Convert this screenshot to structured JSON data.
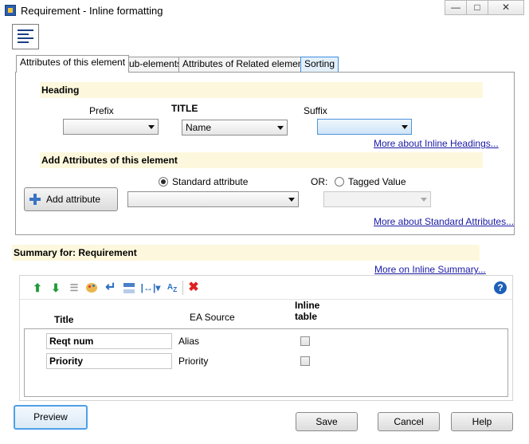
{
  "window": {
    "title": "Requirement - Inline formatting",
    "minimize_glyph": "—",
    "maximize_glyph": "□",
    "close_glyph": "✕"
  },
  "tabs": [
    {
      "label": "Attributes of this element",
      "selected": true
    },
    {
      "label": "Sub-elements",
      "selected": false
    },
    {
      "label": "Attributes of Related elements",
      "selected": false
    },
    {
      "label": "Sorting",
      "selected": false
    }
  ],
  "heading": {
    "section_title": "Heading",
    "prefix_label": "Prefix",
    "prefix_value": "",
    "title_label": "TITLE",
    "title_value": "Name",
    "suffix_label": "Suffix",
    "suffix_value": "",
    "more_link": "More about Inline Headings..."
  },
  "add_attributes": {
    "section_title": "Add Attributes of this element",
    "add_button": "Add attribute",
    "standard_label": "Standard attribute",
    "standard_selected": true,
    "standard_value": "",
    "or_label": "OR:",
    "tagged_label": "Tagged Value",
    "tagged_value": "",
    "more_link": "More about Standard Attributes..."
  },
  "summary": {
    "section_title": "Summary for: Requirement",
    "more_link": "More on Inline Summary...",
    "help_glyph": "?",
    "columns": {
      "title": "Title",
      "source": "EA Source",
      "inline": "Inline table"
    },
    "rows": [
      {
        "title": "Reqt num",
        "source": "Alias",
        "inline_table": false
      },
      {
        "title": "Priority",
        "source": "Priority",
        "inline_table": false
      }
    ]
  },
  "icons": {
    "move_up": "up-arrow-icon",
    "move_down": "down-arrow-icon",
    "list": "list-icon",
    "palette": "palette-icon",
    "newline": "newline-icon",
    "separator": "separator-icon",
    "width": "width-icon",
    "sort": "sort-az-icon",
    "delete": "delete-icon"
  },
  "colors": {
    "section_bg": "#fdf8dd",
    "link": "#1a1aa6",
    "accent": "#4fa0e6",
    "delete": "#e02020",
    "help": "#1e5fb8"
  },
  "buttons": {
    "preview": "Preview",
    "save": "Save",
    "cancel": "Cancel",
    "help": "Help"
  }
}
